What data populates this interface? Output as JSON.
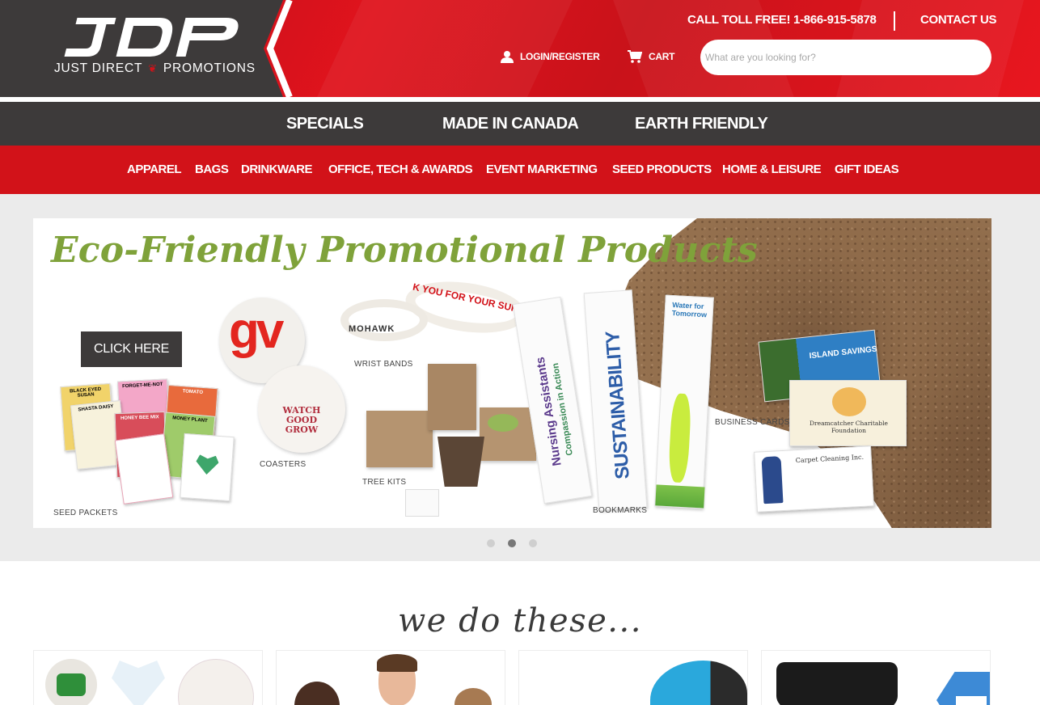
{
  "brand": {
    "logo_text": "JDP",
    "tagline_left": "JUST DIRECT",
    "tagline_right": "PROMOTIONS",
    "leaf_icon": "maple-leaf-icon"
  },
  "header": {
    "toll_free": "CALL TOLL FREE! 1-866-915-5878",
    "contact": "CONTACT US",
    "login": "LOGIN/REGISTER",
    "cart": "CART",
    "search_placeholder": "What are you looking for?",
    "colors": {
      "dark": "#3d3a3a",
      "red": "#d21219"
    }
  },
  "nav_primary": [
    {
      "label": "SPECIALS"
    },
    {
      "label": "MADE IN CANADA"
    },
    {
      "label": "EARTH FRIENDLY"
    }
  ],
  "nav_categories": [
    {
      "label": "APPAREL"
    },
    {
      "label": "BAGS"
    },
    {
      "label": "DRINKWARE"
    },
    {
      "label": "OFFICE, TECH & AWARDS"
    },
    {
      "label": "EVENT MARKETING"
    },
    {
      "label": "SEED PRODUCTS"
    },
    {
      "label": "HOME & LEISURE"
    },
    {
      "label": "GIFT IDEAS"
    }
  ],
  "hero": {
    "title": "Eco-Friendly Promotional Products",
    "cta": "CLICK HERE",
    "labels": {
      "seed_packets": "SEED PACKETS",
      "coasters": "COASTERS",
      "wrist_bands": "WRIST BANDS",
      "tree_kits": "TREE KITS",
      "bookmarks": "BOOKMARKS",
      "business_cards": "BUSINESS CARDS"
    },
    "product_text": {
      "coaster_gv": "gv",
      "coaster_watch": "WATCH GOOD GROW",
      "wristband_brand": "MOHAWK",
      "wristband_slogan": "K YOU FOR YOUR SUPP",
      "bookmark_1": "Nursing Assistants",
      "bookmark_1b": "Compassion in Action",
      "bookmark_2": "SUSTAINABILITY",
      "bookmark_3": "Water for Tomorrow",
      "card_1": "ISLAND SAVINGS",
      "card_2": "Dreamcatcher Charitable Foundation",
      "card_3": "Carpet Cleaning Inc.",
      "seed_1": "BLACK EYED SUSAN",
      "seed_2": "FORGET-ME-NOT",
      "seed_3": "SHASTA DAISY",
      "seed_4": "TOMATO",
      "seed_5": "HONEY BEE MIX",
      "seed_6": "MONEY PLANT"
    },
    "slider": {
      "total": 3,
      "active_index": 2
    }
  },
  "section": {
    "title": "we do these...",
    "tiles": [
      {
        "name": "tile-seed-paper"
      },
      {
        "name": "tile-apparel"
      },
      {
        "name": "tile-caps"
      },
      {
        "name": "tile-masks"
      }
    ]
  }
}
